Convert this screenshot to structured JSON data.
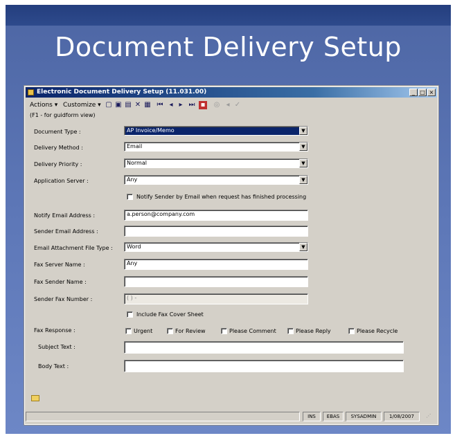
{
  "slide": {
    "title": "Document Delivery Setup"
  },
  "window": {
    "title": "Electronic Document Delivery Setup (11.031.00)",
    "controls": {
      "minimize": "_",
      "maximize": "□",
      "close": "×"
    }
  },
  "menu": {
    "actions": "Actions ▾",
    "customize": "Customize ▾"
  },
  "toolbar": [
    "new-icon",
    "save-icon",
    "copy-icon",
    "delete-icon",
    "refresh-icon",
    "first-icon",
    "prev-icon",
    "next-icon",
    "last-icon",
    "close-red-icon",
    "gray-1-icon",
    "gray-2-icon",
    "gray-3-icon"
  ],
  "hint": "(F1 - for guidform view)",
  "form": {
    "document_type": {
      "label": "Document Type :",
      "value": "AP Invoice/Memo"
    },
    "delivery_method": {
      "label": "Delivery Method :",
      "value": "Email"
    },
    "delivery_priority": {
      "label": "Delivery Priority :",
      "value": "Normal"
    },
    "application_server": {
      "label": "Application Server :",
      "value": "Any"
    },
    "notify_checkbox": {
      "label": "Notify Sender by Email when request has finished processing",
      "checked": false
    },
    "notify_email": {
      "label": "Notify Email Address :",
      "value": "a.person@company.com"
    },
    "sender_email": {
      "label": "Sender Email Address :",
      "value": ""
    },
    "attachment_type": {
      "label": "Email Attachment File Type :",
      "value": "Word"
    },
    "fax_server_name": {
      "label": "Fax Server Name :",
      "value": "Any"
    },
    "fax_sender_name": {
      "label": "Fax Sender Name :",
      "value": ""
    },
    "sender_fax_number": {
      "label": "Sender Fax Number :",
      "value": "( )   -"
    },
    "include_cover": {
      "label": "Include Fax Cover Sheet",
      "checked": false
    },
    "fax_response": {
      "label": "Fax Response :",
      "options": [
        "Urgent",
        "For Review",
        "Please Comment",
        "Please Reply",
        "Please Recycle"
      ]
    },
    "subject_text": {
      "label": "Subject Text :",
      "value": ""
    },
    "body_text": {
      "label": "Body Text :",
      "value": ""
    }
  },
  "status": {
    "s1": "INS",
    "s2": "EBAS",
    "s3": "SYSADMIN",
    "s4": "1/08/2007"
  }
}
